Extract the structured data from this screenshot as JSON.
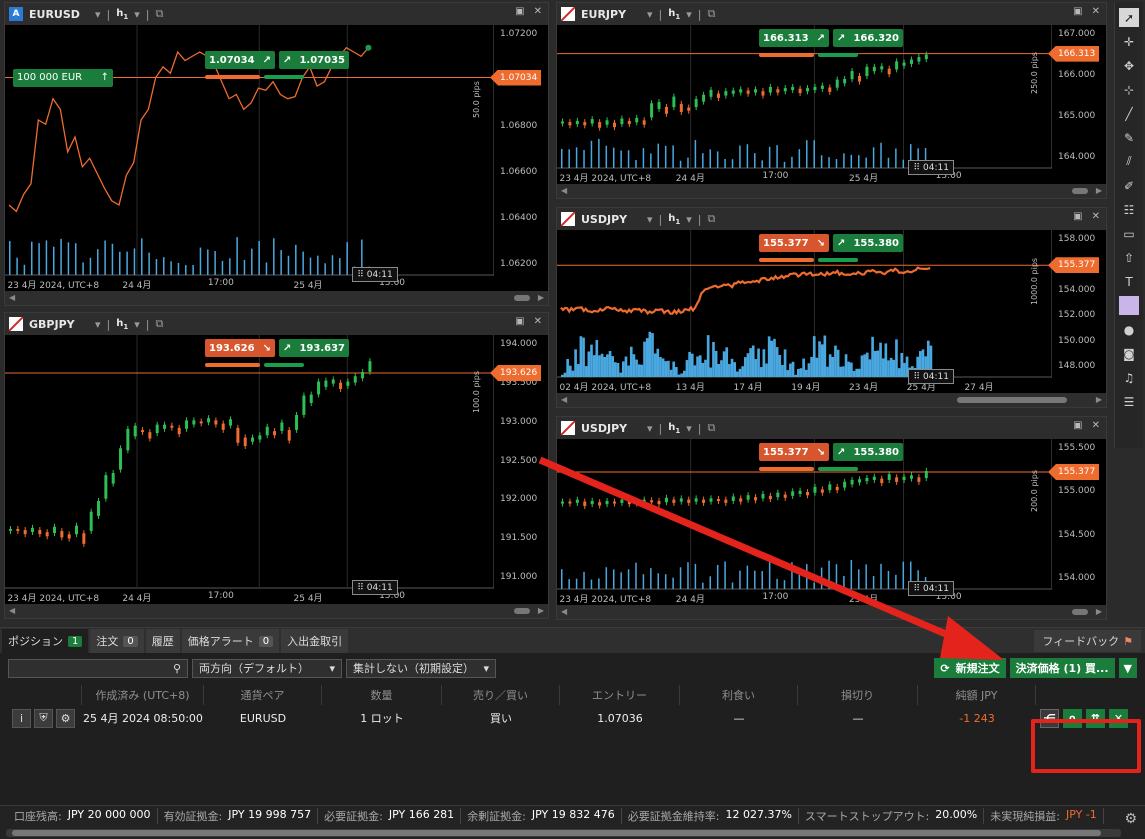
{
  "charts": [
    {
      "symbol": "EURUSD",
      "badge": "A",
      "tf": "h",
      "tf_sub": "1",
      "bid": "1.07034",
      "ask": "1.07035",
      "price": "1.07034",
      "pips": "50.0 pips",
      "clock": "04:11",
      "y_ticks": [
        "1.07200",
        "1.07000",
        "1.06800",
        "1.06600",
        "1.06400",
        "1.06200"
      ],
      "x_labels": [
        "23 4月 2024, UTC+8",
        "24 4月",
        "17:00",
        "25 4月",
        "13:00"
      ],
      "position_label": "100 000 EUR",
      "buy_dir": "up",
      "sell_dir": "up"
    },
    {
      "symbol": "EURJPY",
      "badge": "",
      "tf": "h",
      "tf_sub": "1",
      "bid": "166.313",
      "ask": "166.320",
      "price": "166.313",
      "pips": "250.0 pips",
      "clock": "04:11",
      "y_ticks": [
        "167.000",
        "166.000",
        "165.000",
        "164.000"
      ],
      "x_labels": [
        "23 4月 2024, UTC+8",
        "24 4月",
        "17:00",
        "25 4月",
        "13:00"
      ],
      "buy_dir": "up",
      "sell_dir": "up"
    },
    {
      "symbol": "USDJPY",
      "badge": "",
      "tf": "h",
      "tf_sub": "1",
      "bid": "155.377",
      "ask": "155.380",
      "price": "155.377",
      "pips": "1000.0 pips",
      "clock": "04:11",
      "y_ticks": [
        "158.000",
        "156.000",
        "154.000",
        "152.000",
        "150.000",
        "148.000"
      ],
      "x_labels": [
        "02 4月 2024, UTC+8",
        "13 4月",
        "17 4月",
        "19 4月",
        "23 4月",
        "25 4月",
        "27 4月"
      ],
      "buy_dir": "up",
      "sell_dir": "down"
    },
    {
      "symbol": "GBPJPY",
      "badge": "",
      "tf": "h",
      "tf_sub": "1",
      "bid": "193.626",
      "ask": "193.637",
      "price": "193.626",
      "pips": "100.0 pips",
      "clock": "04:11",
      "y_ticks": [
        "194.000",
        "193.500",
        "193.000",
        "192.500",
        "192.000",
        "191.500",
        "191.000"
      ],
      "x_labels": [
        "23 4月 2024, UTC+8",
        "24 4月",
        "17:00",
        "25 4月",
        "13:00"
      ],
      "buy_dir": "up",
      "sell_dir": "down"
    },
    {
      "symbol": "USDJPY",
      "badge": "",
      "tf": "h",
      "tf_sub": "1",
      "bid": "155.377",
      "ask": "155.380",
      "price": "155.377",
      "pips": "200.0 pips",
      "clock": "04:11",
      "y_ticks": [
        "155.500",
        "155.000",
        "154.500",
        "154.000"
      ],
      "x_labels": [
        "23 4月 2024, UTC+8",
        "24 4月",
        "17:00",
        "25 4月",
        "13:00"
      ],
      "buy_dir": "up",
      "sell_dir": "down"
    }
  ],
  "tabs": [
    {
      "label": "ポジション",
      "count": "1"
    },
    {
      "label": "注文",
      "count": "0"
    },
    {
      "label": "履歴",
      "count": ""
    },
    {
      "label": "価格アラート",
      "count": "0"
    },
    {
      "label": "入出金取引",
      "count": ""
    }
  ],
  "feedback": "フィードバック",
  "filters": {
    "search_value": "",
    "direction": "両方向（デフォルト）",
    "aggregate": "集計しない（初期設定）"
  },
  "buttons": {
    "new_order": "新規注文",
    "close_price": "決済価格 (1) 買..."
  },
  "table": {
    "headers": [
      "作成済み (UTC+8)",
      "通貨ペア",
      "数量",
      "売り／買い",
      "エントリー",
      "利食い",
      "損切り",
      "純額 JPY"
    ],
    "row": {
      "created": "25 4月 2024 08:50:00",
      "pair": "EURUSD",
      "qty": "1 ロット",
      "side": "買い",
      "entry": "1.07036",
      "tp": "—",
      "sl": "—",
      "net": "-1 243"
    }
  },
  "status": [
    {
      "label": "口座残高:",
      "value": "JPY 20 000 000"
    },
    {
      "label": "有効証拠金:",
      "value": "JPY 19 998 757"
    },
    {
      "label": "必要証拠金:",
      "value": "JPY 166 281"
    },
    {
      "label": "余剰証拠金:",
      "value": "JPY 19 832 476"
    },
    {
      "label": "必要証拠金維持率:",
      "value": "12 027.37%"
    },
    {
      "label": "スマートストップアウト:",
      "value": "20.00%"
    },
    {
      "label": "未実現純損益:",
      "value": "JPY -1"
    }
  ],
  "colors": {
    "buy": "#1a7d3c",
    "sell": "#d8562d",
    "price": "#ef6c2f",
    "volume": "#4aa8e0",
    "annotation": "#e3231c"
  }
}
